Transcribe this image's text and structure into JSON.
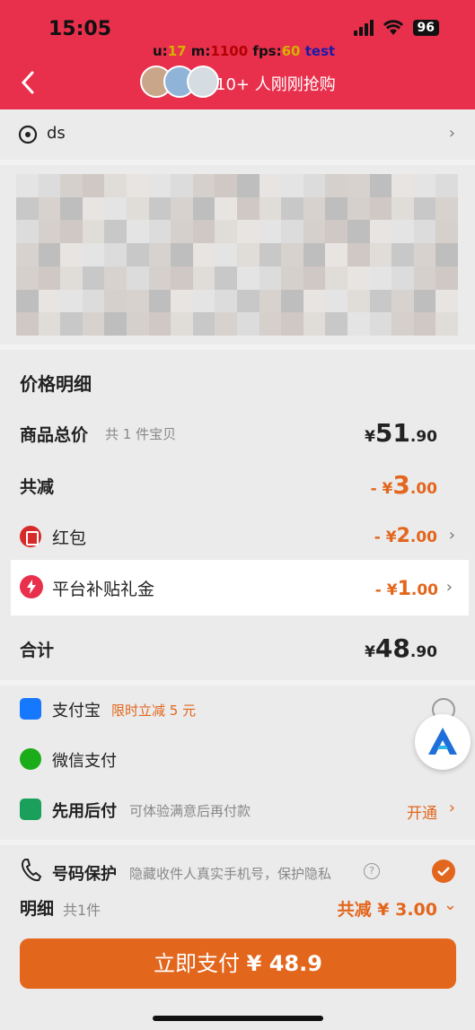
{
  "status_bar": {
    "time": "15:05",
    "battery": "96"
  },
  "debug": {
    "u_label": "u:",
    "u_value": "17",
    "m_label": "m:",
    "m_value": "1100",
    "fps_label": "fps:",
    "fps_value": "60",
    "test": "test"
  },
  "header": {
    "buying_text": "10+ 人刚刚抢购"
  },
  "address": {
    "text": "ds"
  },
  "price_detail": {
    "title": "价格明细",
    "goods_total": {
      "label": "商品总价",
      "sub": "共 1 件宝贝",
      "currency": "¥",
      "int": "51",
      "dec": ".90"
    },
    "total_reduce": {
      "label": "共减",
      "prefix": "- ¥",
      "int": "3",
      "dec": ".00"
    },
    "red_packet": {
      "label": "红包",
      "prefix": "- ¥",
      "int": "2",
      "dec": ".00"
    },
    "subsidy": {
      "label": "平台补贴礼金",
      "prefix": "- ¥",
      "int": "1",
      "dec": ".00"
    },
    "sum": {
      "label": "合计",
      "currency": "¥",
      "int": "48",
      "dec": ".90"
    }
  },
  "payment": {
    "alipay": {
      "label": "支付宝",
      "promo": "限时立减 5 元"
    },
    "wechat": {
      "label": "微信支付"
    },
    "later": {
      "label": "先用后付",
      "desc": "可体验满意后再付款",
      "action": "开通"
    }
  },
  "bottom": {
    "privacy_label": "号码保护",
    "privacy_desc": "隐藏收件人真实手机号，保护隐私",
    "detail_label": "明细",
    "detail_count": "共1件",
    "detail_reduce": "共减 ¥ 3.00",
    "pay_label": "立即支付",
    "pay_amount": "¥ 48.9"
  },
  "colors": {
    "header_red": "#e8304d",
    "accent_orange": "#e3661d"
  }
}
